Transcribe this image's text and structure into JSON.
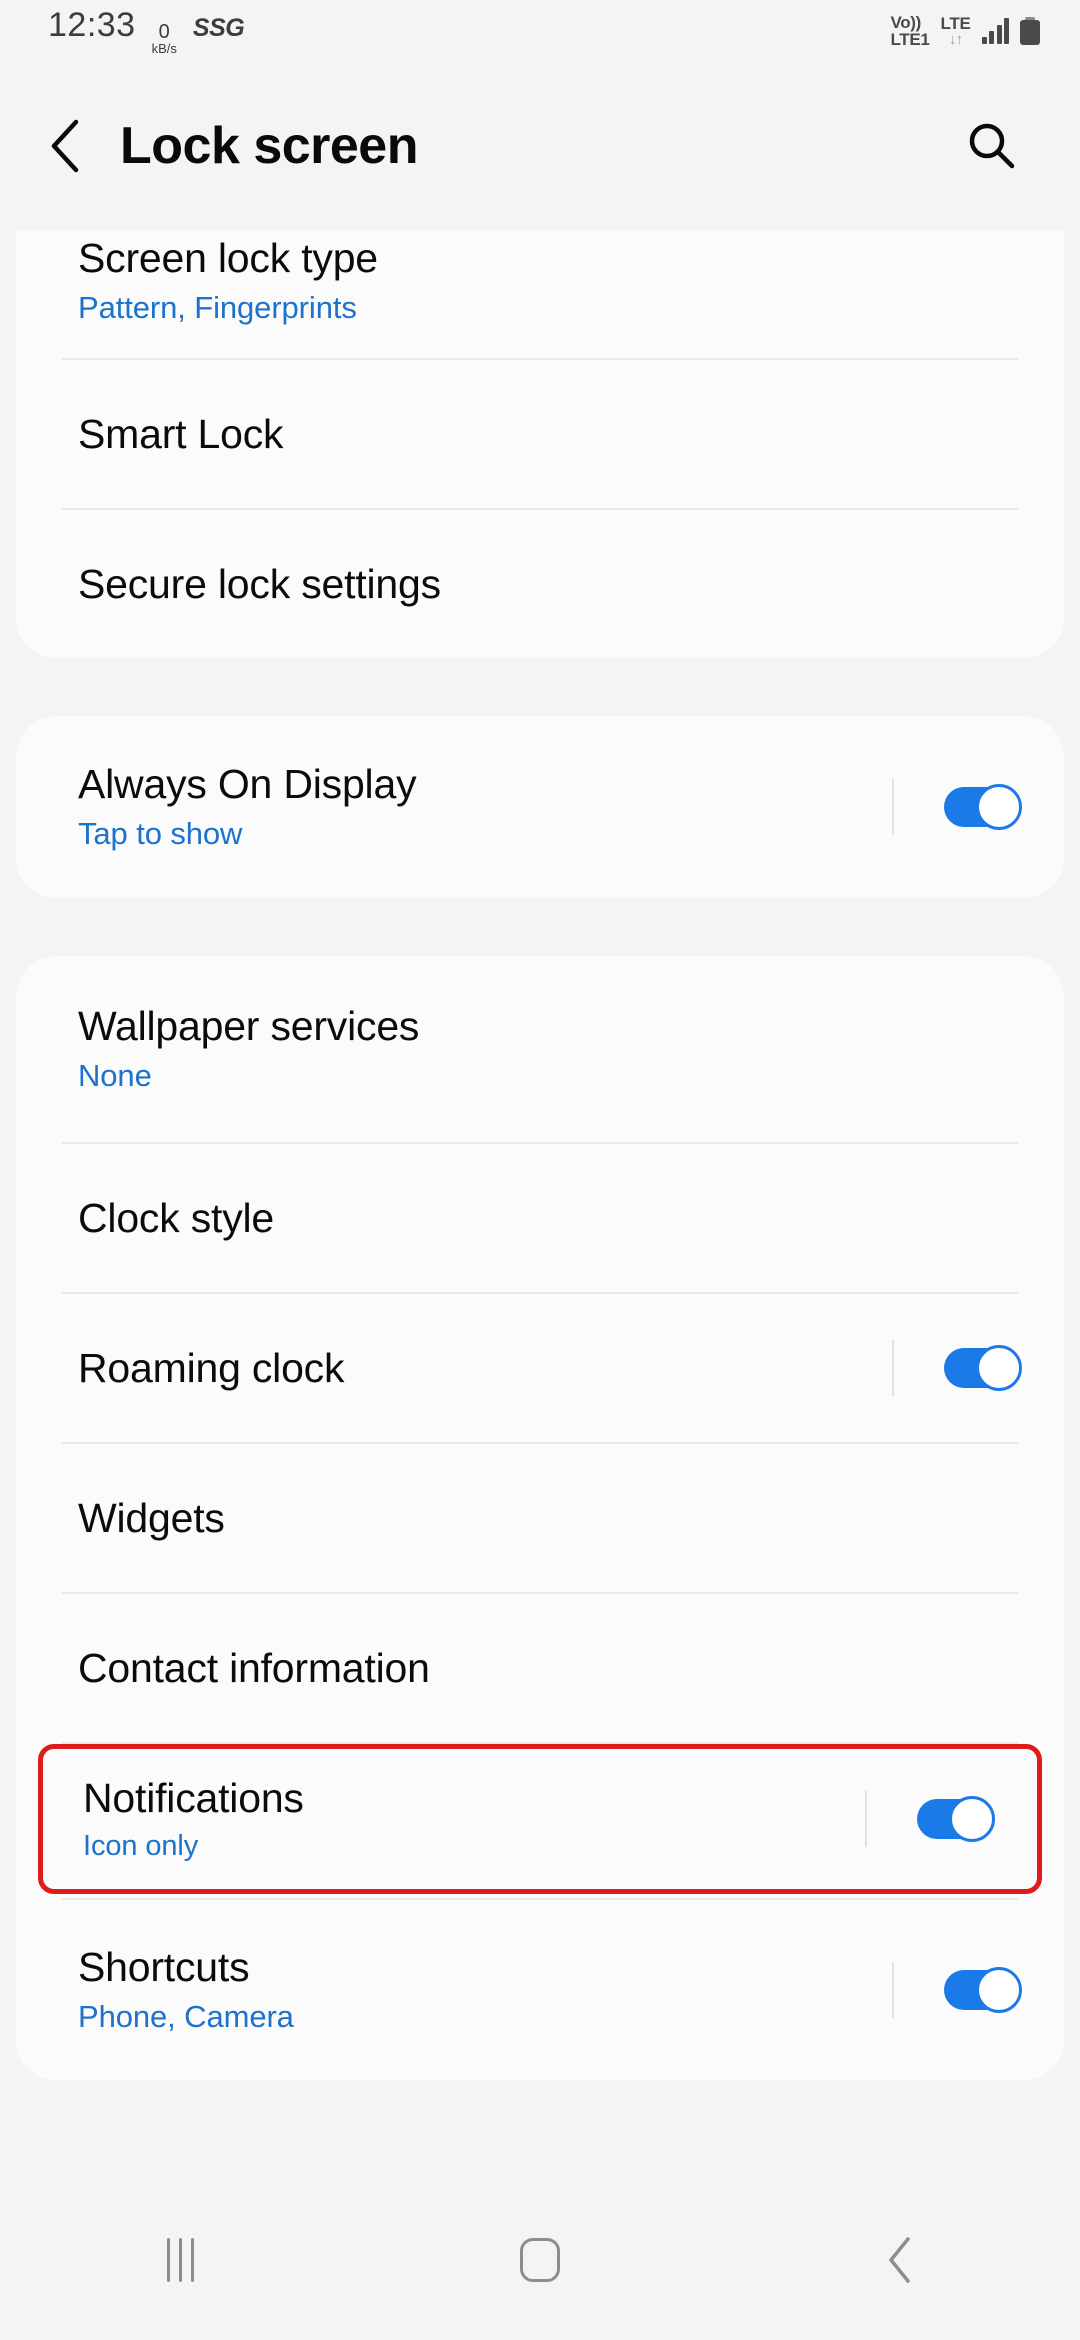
{
  "status_bar": {
    "time": "12:33",
    "net_speed_value": "0",
    "net_speed_unit": "kB/s",
    "carrier_logo": "SSG",
    "volte_top": "Vo))",
    "volte_bottom": "LTE1",
    "network_type": "LTE",
    "data_arrows": "↓↑",
    "signal_icon": "signal-bars-icon",
    "battery_icon": "battery-icon"
  },
  "header": {
    "back_icon": "back-chevron-icon",
    "title": "Lock screen",
    "search_icon": "search-icon"
  },
  "sections": [
    {
      "clipped_top": true,
      "rows": [
        {
          "title": "Screen lock type",
          "subtitle": "Pattern, Fingerprints",
          "toggle": null
        },
        {
          "title": "Smart Lock",
          "subtitle": null,
          "toggle": null
        },
        {
          "title": "Secure lock settings",
          "subtitle": null,
          "toggle": null
        }
      ]
    },
    {
      "clipped_top": false,
      "rows": [
        {
          "title": "Always On Display",
          "subtitle": "Tap to show",
          "toggle": "on"
        }
      ]
    },
    {
      "clipped_top": false,
      "rows": [
        {
          "title": "Wallpaper services",
          "subtitle": "None",
          "toggle": null
        },
        {
          "title": "Clock style",
          "subtitle": null,
          "toggle": null
        },
        {
          "title": "Roaming clock",
          "subtitle": null,
          "toggle": "on"
        },
        {
          "title": "Widgets",
          "subtitle": null,
          "toggle": null
        },
        {
          "title": "Contact information",
          "subtitle": null,
          "toggle": null
        },
        {
          "title": "Notifications",
          "subtitle": "Icon only",
          "toggle": "on",
          "highlighted": true
        },
        {
          "title": "Shortcuts",
          "subtitle": "Phone, Camera",
          "toggle": "on"
        }
      ]
    }
  ],
  "nav_bar": {
    "recents_icon": "recents-icon",
    "home_icon": "home-icon",
    "back_icon": "back-icon"
  },
  "colors": {
    "accent_blue": "#1a7ae8",
    "subtitle_blue": "#1c73cd",
    "highlight_red": "#de1c1c",
    "page_background": "#f4f4f4",
    "card_background": "#fbfbfb",
    "divider": "#e8e8e8",
    "nav_icon": "#8d8d8d"
  }
}
